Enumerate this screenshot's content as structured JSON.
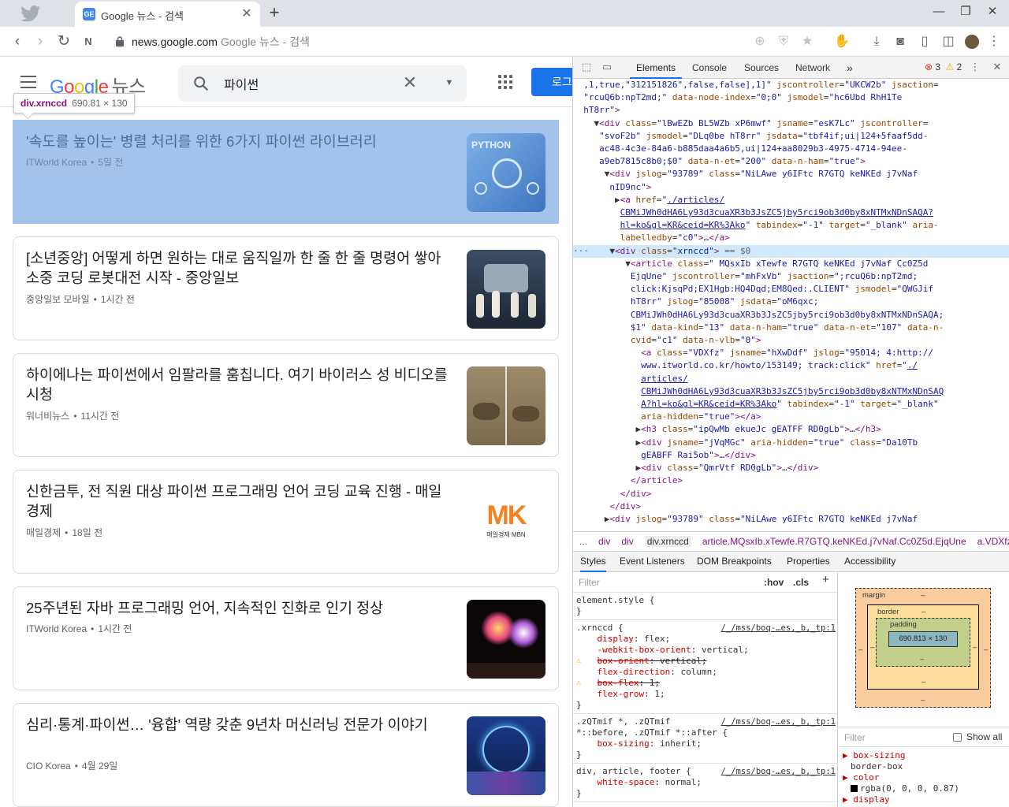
{
  "browser": {
    "tab_title": "Google 뉴스 - 검색",
    "tab_favicon_text": "GE",
    "url_host": "news.google.com",
    "url_title": "Google 뉴스 - 검색",
    "icons": [
      "twitter-icon",
      "back-icon",
      "forward-icon",
      "reload-icon",
      "notion-icon",
      "lock-icon",
      "add-icon",
      "shield-icon",
      "star-icon",
      "extension-icon",
      "download-icon",
      "camera-icon",
      "reader-icon",
      "sidebar-icon",
      "profile-icon",
      "menu-icon"
    ]
  },
  "gnews": {
    "logo_google": "Google",
    "logo_news": "뉴스",
    "search_value": "파이썬",
    "login_label": "로그인",
    "tooltip": {
      "tag": "div.xrnccd",
      "size": "690.81 × 130"
    },
    "articles": [
      {
        "title": "'속도를 높이는' 병렬 처리를 위한 6가지 파이썬 라이브러리",
        "source": "ITWorld Korea",
        "time": "5일 전",
        "thumb": "python"
      },
      {
        "title": "[소년중앙] 어떻게 하면 원하는 대로 움직일까 한 줄 한 줄 명령어 쌓아 소중 코딩 로봇대전 시작 - 중앙일보",
        "source": "중앙일보 모바일",
        "time": "1시간 전",
        "thumb": "robot"
      },
      {
        "title": "하이에나는 파이썬에서 임팔라를 훔칩니다. 여기 바이러스 성 비디오를 시청",
        "source": "워너비뉴스",
        "time": "11시간 전",
        "thumb": "hyena"
      },
      {
        "title": "신한금투, 전 직원 대상 파이썬 프로그래밍 언어 코딩 교육 진행 - 매일경제",
        "source": "매일경제",
        "time": "18일 전",
        "thumb": "mk",
        "thumb_text": "MK",
        "thumb_sub": "매일경제 MBN"
      },
      {
        "title": "25주년된 자바 프로그래밍 언어, 지속적인 진화로 인기 정상",
        "source": "ITWorld Korea",
        "time": "1시간 전",
        "thumb": "fireworks"
      },
      {
        "title": "심리·통계·파이썬… '융합' 역량 갖춘 9년차 머신러닝 전문가 이야기",
        "source": "CIO Korea",
        "time": "4월 29일",
        "thumb": "city"
      }
    ]
  },
  "devtools": {
    "tabs": [
      "Elements",
      "Console",
      "Sources",
      "Network"
    ],
    "more": "»",
    "errors": "3",
    "warnings": "2",
    "crumbs": [
      "...",
      "div",
      "div",
      "div.xrnccd",
      "article.MQsxIb.xTewfe.R7GTQ.keNKEd.j7vNaf.Cc0Z5d.EjqUne",
      "a.VDXfz"
    ],
    "sub_tabs": [
      "Styles",
      "Event Listeners",
      "DOM Breakpoints",
      "Properties",
      "Accessibility"
    ],
    "filter_placeholder": "Filter",
    "hov": ":hov",
    "cls": ".cls",
    "computed_filter": "Filter",
    "show_all": "Show all",
    "box_model": {
      "margin": "margin",
      "border": "border",
      "padding": "padding",
      "content": "690.813 × 130",
      "dash": "–"
    },
    "computed": [
      {
        "prop": "box-sizing",
        "val": "border-box"
      },
      {
        "prop": "color",
        "val": "rgba(0, 0, 0, 0.87)"
      },
      {
        "prop": "display",
        "val": ""
      }
    ]
  }
}
